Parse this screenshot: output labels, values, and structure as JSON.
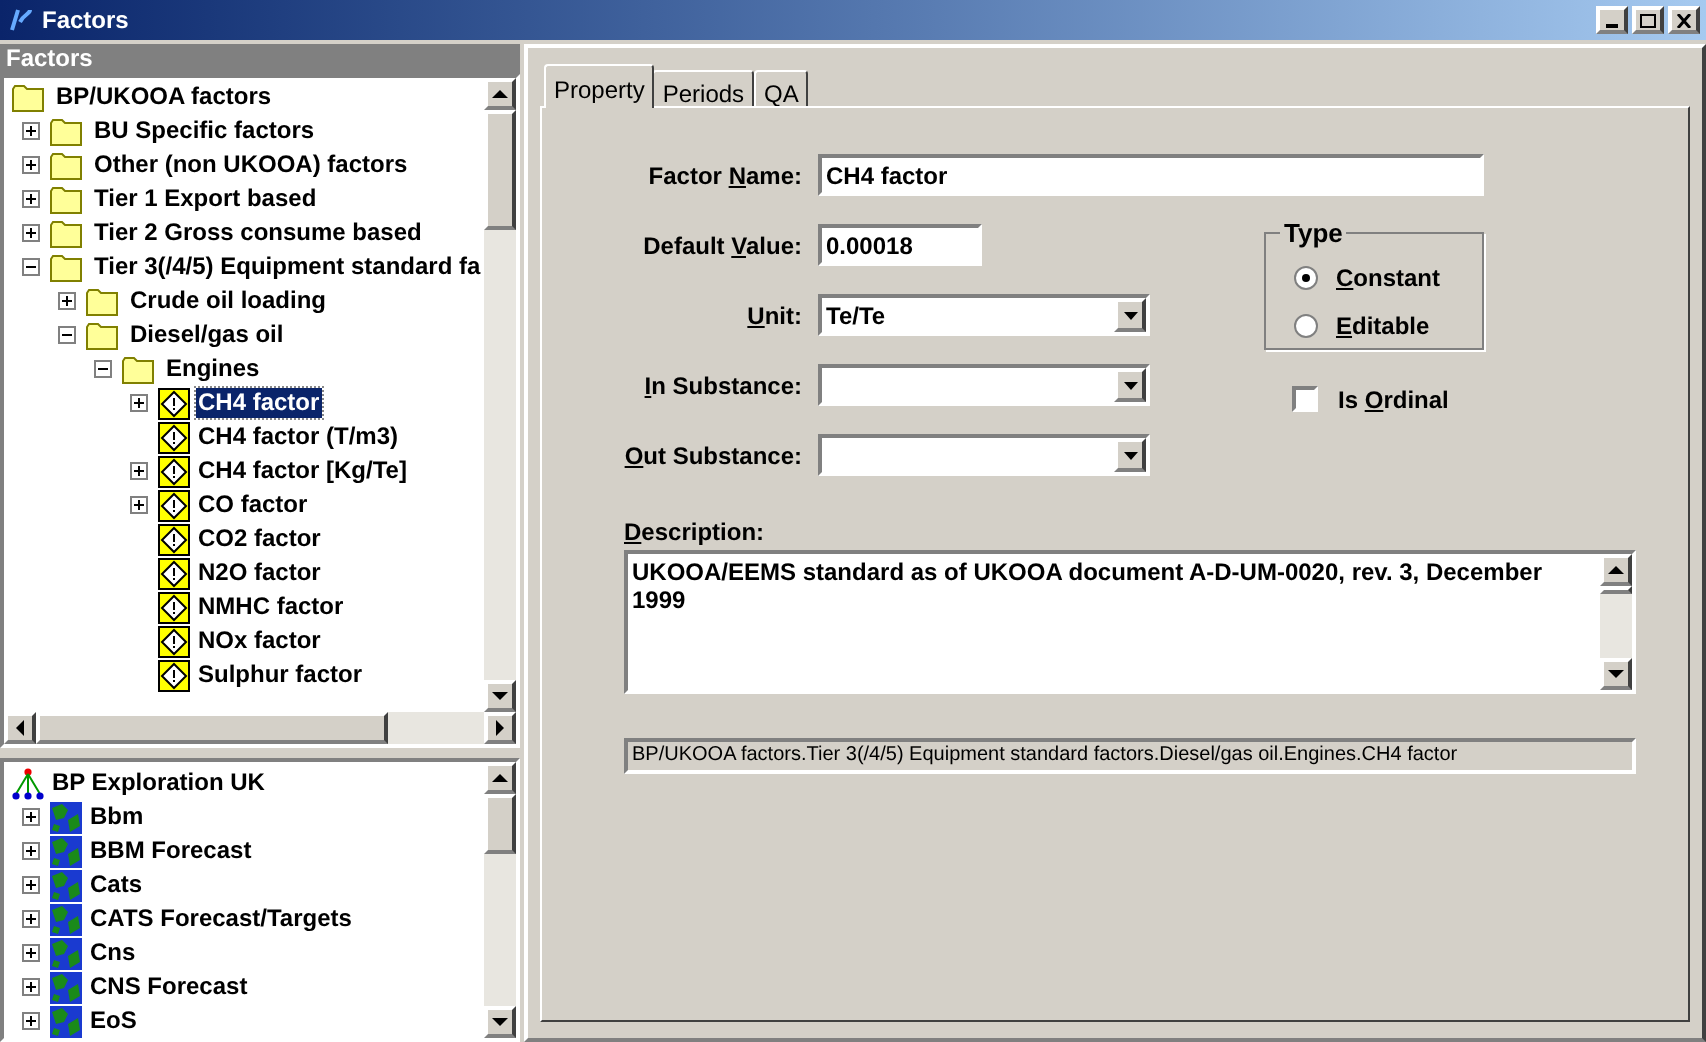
{
  "window": {
    "title": "Factors"
  },
  "left_panel": {
    "title": "Factors"
  },
  "factor_tree": [
    {
      "label": "BP/UKOOA factors",
      "kind": "folder",
      "selected": false,
      "children": [
        {
          "label": "BU Specific factors",
          "kind": "folder",
          "expanded": false,
          "selected": false
        },
        {
          "label": "Other (non UKOOA) factors",
          "kind": "folder",
          "expanded": false,
          "selected": false
        },
        {
          "label": "Tier 1 Export based",
          "kind": "folder",
          "expanded": false,
          "selected": false
        },
        {
          "label": "Tier 2 Gross consume based",
          "kind": "folder",
          "expanded": false,
          "selected": false
        },
        {
          "label": "Tier 3(/4/5) Equipment standard fa",
          "kind": "folder",
          "expanded": true,
          "selected": false,
          "children": [
            {
              "label": "Crude oil loading",
              "kind": "folder",
              "expanded": false,
              "selected": false
            },
            {
              "label": "Diesel/gas oil",
              "kind": "folder",
              "expanded": true,
              "selected": false,
              "children": [
                {
                  "label": "Engines",
                  "kind": "folder",
                  "expanded": true,
                  "selected": false,
                  "children": [
                    {
                      "label": "CH4 factor",
                      "kind": "factor",
                      "expanded": false,
                      "selected": true
                    },
                    {
                      "label": "CH4 factor (T/m3)",
                      "kind": "factor",
                      "selected": false
                    },
                    {
                      "label": "CH4 factor [Kg/Te]",
                      "kind": "factor",
                      "expanded": false,
                      "selected": false
                    },
                    {
                      "label": "CO factor",
                      "kind": "factor",
                      "expanded": false,
                      "selected": false
                    },
                    {
                      "label": "CO2 factor",
                      "kind": "factor",
                      "selected": false
                    },
                    {
                      "label": "N2O factor",
                      "kind": "factor",
                      "selected": false
                    },
                    {
                      "label": "NMHC factor",
                      "kind": "factor",
                      "selected": false
                    },
                    {
                      "label": "NOx factor",
                      "kind": "factor",
                      "selected": false
                    },
                    {
                      "label": "Sulphur factor",
                      "kind": "factor",
                      "selected": false
                    }
                  ]
                }
              ]
            }
          ]
        }
      ]
    }
  ],
  "unit_tree": [
    {
      "label": "BP Exploration UK",
      "kind": "organisation",
      "selected": false,
      "children": [
        {
          "label": "Bbm",
          "kind": "unit",
          "expanded": false,
          "selected": false
        },
        {
          "label": "BBM Forecast",
          "kind": "unit",
          "expanded": false,
          "selected": false
        },
        {
          "label": "Cats",
          "kind": "unit",
          "expanded": false,
          "selected": false
        },
        {
          "label": "CATS Forecast/Targets",
          "kind": "unit",
          "expanded": false,
          "selected": false
        },
        {
          "label": "Cns",
          "kind": "unit",
          "expanded": false,
          "selected": false
        },
        {
          "label": "CNS Forecast",
          "kind": "unit",
          "expanded": false,
          "selected": false
        },
        {
          "label": "EoS",
          "kind": "unit",
          "expanded": false,
          "selected": false
        }
      ]
    }
  ],
  "tabs": [
    {
      "label": "Property",
      "selected": true
    },
    {
      "label": "Periods",
      "selected": false
    },
    {
      "label": "QA",
      "selected": false
    }
  ],
  "form": {
    "factor_name": {
      "label_start": "Factor ",
      "access_key": "N",
      "label_end": "ame:",
      "value": "CH4 factor"
    },
    "default_value": {
      "label_start": "Default ",
      "access_key": "V",
      "label_end": "alue:",
      "value": "0.00018"
    },
    "unit": {
      "access_key": "U",
      "label_end": "nit:",
      "value": "Te/Te"
    },
    "in_substance": {
      "access_key": "I",
      "label_end": "n Substance:"
    },
    "out_substance": {
      "access_key": "O",
      "label_end": "ut Substance:"
    },
    "type": {
      "title": "Type",
      "options": [
        {
          "access_key": "C",
          "label_end": "onstant",
          "selected": true
        },
        {
          "access_key": "E",
          "label_end": "ditable",
          "selected": false
        }
      ]
    },
    "is_ordinal": {
      "label_start": "Is ",
      "access_key": "O",
      "label_end": "rdinal",
      "checked": false
    },
    "description": {
      "access_key": "D",
      "label_end": "escription:",
      "value": "UKOOA/EEMS standard as of UKOOA document A-D-UM-0020, rev. 3, December 1999"
    },
    "path": "BP/UKOOA factors.Tier 3(/4/5) Equipment standard factors.Diesel/gas oil.Engines.CH4 factor"
  }
}
